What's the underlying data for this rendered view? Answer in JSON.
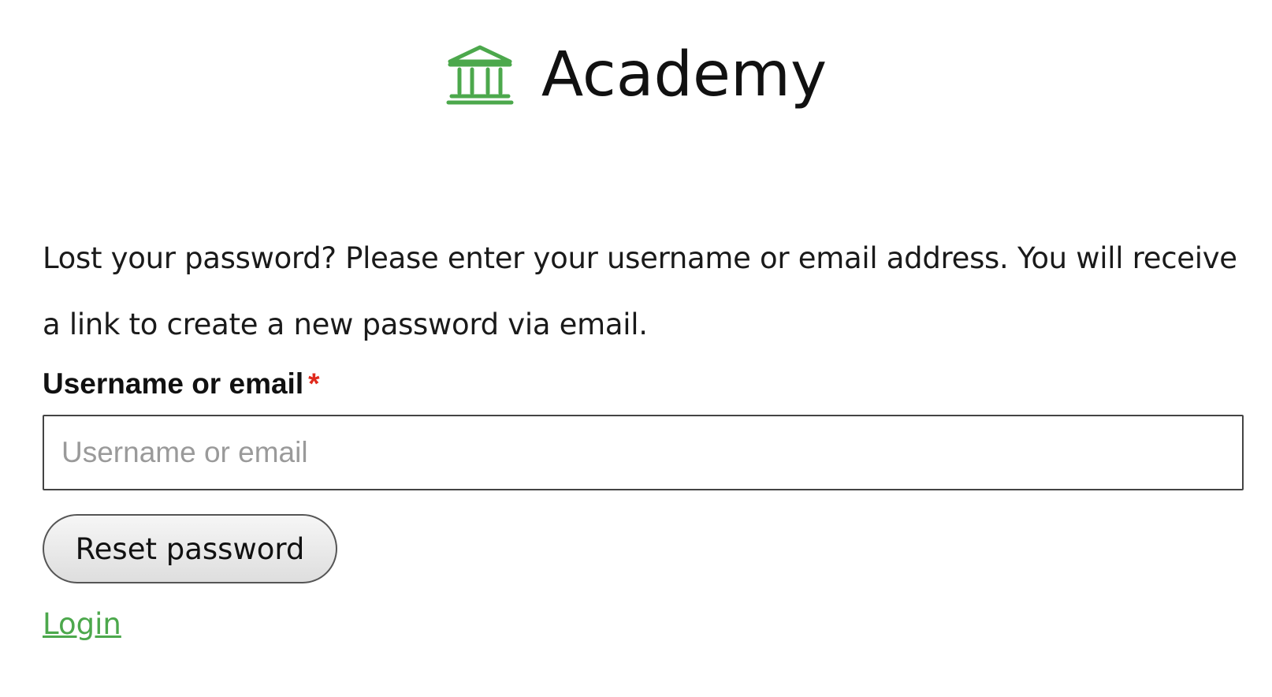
{
  "brand": {
    "title": "Academy",
    "icon": "bank-building-icon",
    "accent_color": "#4ca84c"
  },
  "form": {
    "intro": "Lost your password? Please enter your username or email address. You will receive a link to create a new password via email.",
    "field_label": "Username or email",
    "required_mark": "*",
    "input_placeholder": "Username or email",
    "input_value": "",
    "submit_label": "Reset password"
  },
  "links": {
    "login_label": "Login"
  },
  "colors": {
    "required": "#e02a1d",
    "link": "#4ca84c"
  }
}
